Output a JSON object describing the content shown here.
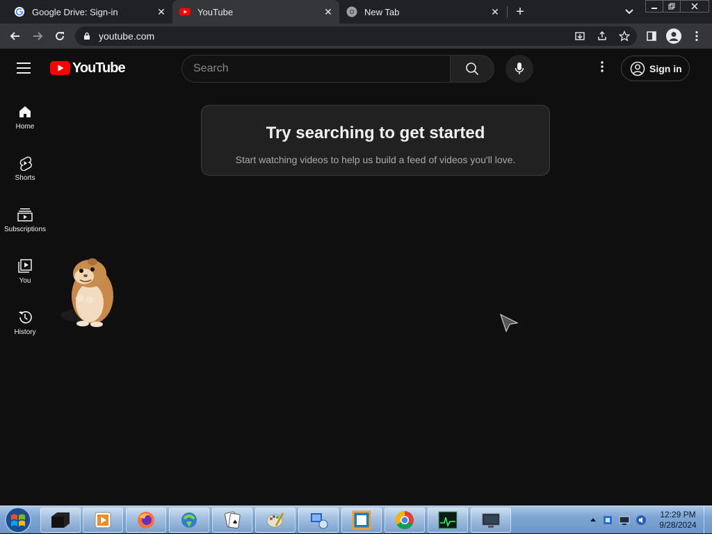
{
  "browser": {
    "tabs": [
      {
        "title": "Google Drive: Sign-in",
        "favicon": "google-icon",
        "active": false
      },
      {
        "title": "YouTube",
        "favicon": "youtube-icon",
        "active": true
      },
      {
        "title": "New Tab",
        "favicon": "chrome-icon",
        "active": false
      }
    ],
    "url": "youtube.com"
  },
  "youtube": {
    "logo_text": "YouTube",
    "search_placeholder": "Search",
    "sign_in_label": "Sign in",
    "nav": [
      {
        "label": "Home",
        "icon": "home-icon"
      },
      {
        "label": "Shorts",
        "icon": "shorts-icon"
      },
      {
        "label": "Subscriptions",
        "icon": "subscriptions-icon"
      },
      {
        "label": "You",
        "icon": "you-icon"
      },
      {
        "label": "History",
        "icon": "history-icon"
      }
    ],
    "card": {
      "title": "Try searching to get started",
      "subtitle": "Start watching videos to help us build a feed of videos you'll love."
    }
  },
  "taskbar": {
    "apps": [
      "media-icon",
      "vlc-icon",
      "firefox-icon",
      "download-manager-icon",
      "solitaire-icon",
      "paint-icon",
      "network-icon",
      "virtualbox-icon",
      "chrome-icon",
      "task-manager-icon",
      "remote-desktop-icon"
    ],
    "time": "12:29 PM",
    "date": "9/28/2024"
  },
  "colors": {
    "youtube_red": "#ff0000",
    "background": "#0f0f0f",
    "chrome_tab_bg": "#202124",
    "chrome_toolbar": "#35363a"
  }
}
